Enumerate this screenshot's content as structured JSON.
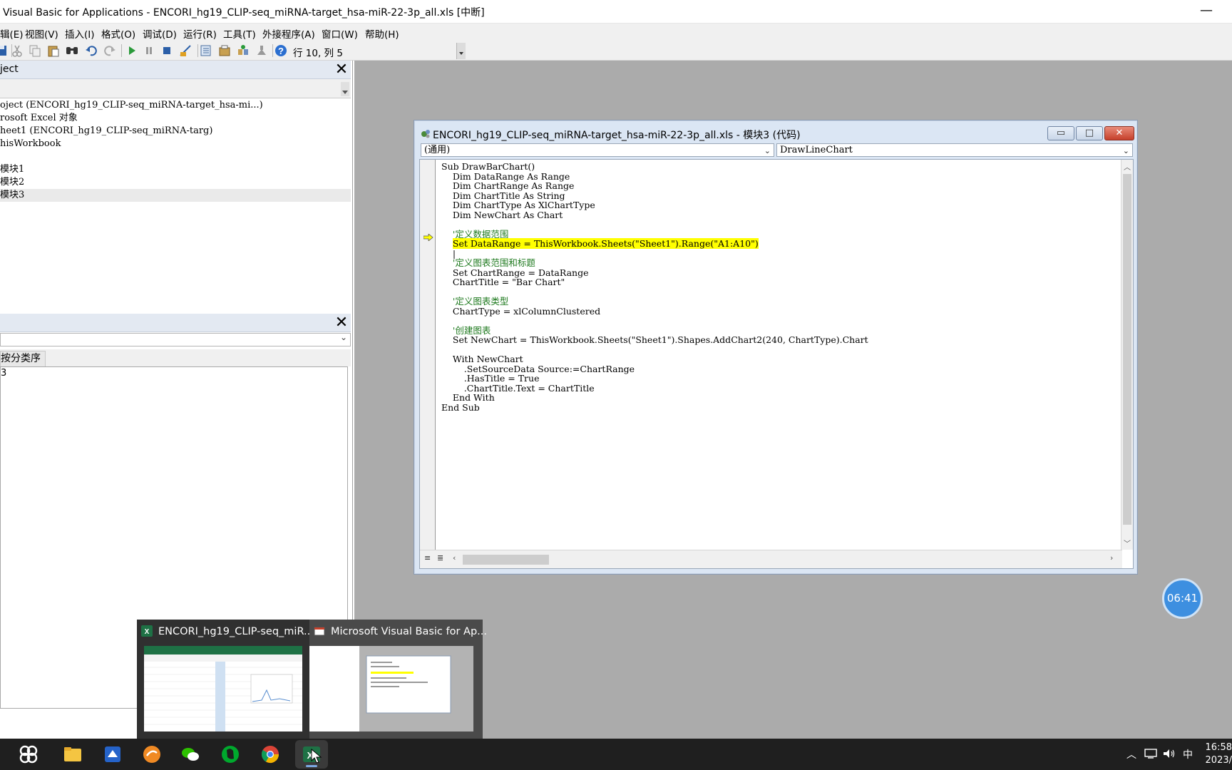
{
  "window": {
    "title": "Visual Basic for Applications - ENCORI_hg19_CLIP-seq_miRNA-target_hsa-miR-22-3p_all.xls [中断]",
    "minimize": "—"
  },
  "menu": [
    "辑(E)",
    "视图(V)",
    "插入(I)",
    "格式(O)",
    "调试(D)",
    "运行(R)",
    "工具(T)",
    "外接程序(A)",
    "窗口(W)",
    "帮助(H)"
  ],
  "toolbar": {
    "icons": [
      "save-icon",
      "cut-icon",
      "copy-icon",
      "paste-icon",
      "find-icon",
      "undo-icon",
      "redo-icon",
      "run-icon",
      "break-icon",
      "reset-icon",
      "design-mode-icon",
      "project-explorer-icon",
      "properties-icon",
      "object-browser-icon",
      "toolbox-icon",
      "help-icon"
    ],
    "cursor_position": "行 10, 列 5"
  },
  "project_pane": {
    "title": "ject",
    "close": "✕",
    "tree": [
      "oject (ENCORI_hg19_CLIP-seq_miRNA-target_hsa-mi...)",
      "rosoft Excel 对象",
      "heet1 (ENCORI_hg19_CLIP-seq_miRNA-targ)",
      "hisWorkbook",
      "",
      "模块1",
      "模块2",
      "模块3"
    ]
  },
  "properties_pane": {
    "close": "✕",
    "tab": "按分类序",
    "first_cell": "3"
  },
  "code_window": {
    "title": "ENCORI_hg19_CLIP-seq_miRNA-target_hsa-miR-22-3p_all.xls - 模块3 (代码)",
    "object_combo": "(通用)",
    "procedure_combo": "DrawLineChart",
    "buttons": {
      "minimize": "▭",
      "maximize": "□",
      "close": "✕"
    },
    "code_lines": [
      {
        "text": "Sub DrawBarChart()",
        "type": "code"
      },
      {
        "text": "    Dim DataRange As Range",
        "type": "code"
      },
      {
        "text": "    Dim ChartRange As Range",
        "type": "code"
      },
      {
        "text": "    Dim ChartTitle As String",
        "type": "code"
      },
      {
        "text": "    Dim ChartType As XlChartType",
        "type": "code"
      },
      {
        "text": "    Dim NewChart As Chart",
        "type": "code"
      },
      {
        "text": "",
        "type": "code"
      },
      {
        "text": "    '定义数据范围",
        "type": "comment"
      },
      {
        "text": "    Set DataRange = ThisWorkbook.Sheets(\"Sheet1\").Range(\"A1:A10\")",
        "type": "highlight"
      },
      {
        "text": "    |",
        "type": "code"
      },
      {
        "text": "    '定义图表范围和标题",
        "type": "comment"
      },
      {
        "text": "    Set ChartRange = DataRange",
        "type": "code"
      },
      {
        "text": "    ChartTitle = \"Bar Chart\"",
        "type": "code"
      },
      {
        "text": "",
        "type": "code"
      },
      {
        "text": "    '定义图表类型",
        "type": "comment"
      },
      {
        "text": "    ChartType = xlColumnClustered",
        "type": "code"
      },
      {
        "text": "",
        "type": "code"
      },
      {
        "text": "    '创建图表",
        "type": "comment"
      },
      {
        "text": "    Set NewChart = ThisWorkbook.Sheets(\"Sheet1\").Shapes.AddChart2(240, ChartType).Chart",
        "type": "code"
      },
      {
        "text": "",
        "type": "code"
      },
      {
        "text": "    With NewChart",
        "type": "code"
      },
      {
        "text": "        .SetSourceData Source:=ChartRange",
        "type": "code"
      },
      {
        "text": "        .HasTitle = True",
        "type": "code"
      },
      {
        "text": "        .ChartTitle.Text = ChartTitle",
        "type": "code"
      },
      {
        "text": "    End With",
        "type": "code"
      },
      {
        "text": "End Sub",
        "type": "code"
      }
    ]
  },
  "timer": "06:41",
  "thumbnails": [
    {
      "caption": "ENCORI_hg19_CLIP-seq_miR...",
      "icon": "excel-icon"
    },
    {
      "caption": "Microsoft Visual Basic for Ap...",
      "icon": "vba-icon"
    }
  ],
  "taskbar": {
    "apps": [
      "start-icon",
      "file-explorer-icon",
      "mail-icon",
      "sunlogin-icon",
      "wechat-icon",
      "evernote-icon",
      "chrome-icon",
      "excel-icon"
    ],
    "tray": {
      "ime": "中",
      "time": "16:58",
      "date": "2023/"
    }
  },
  "colors": {
    "highlight": "#ffff00",
    "comment": "#1f7a1f",
    "mdi_bg": "#ababab",
    "timer": "#3d8fe0"
  }
}
